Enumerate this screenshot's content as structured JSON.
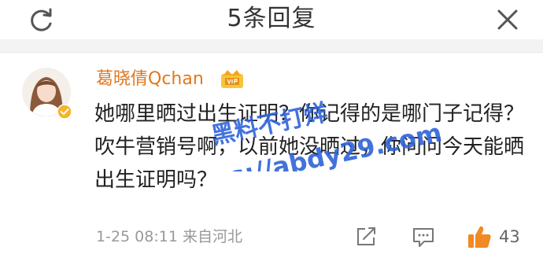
{
  "header": {
    "title": "5条回复",
    "left_icon": "refresh-icon",
    "right_icon": "close-icon"
  },
  "comment": {
    "username": "葛晓倩Qchan",
    "text": "她哪里晒过出生证明？你记得的是哪门子记得？吹牛营销号啊，以前她没晒过，你问问今天能晒出生证明吗？",
    "timestamp": "1-25 08:11",
    "source": "来自河北",
    "like_count": "43",
    "icons": [
      "share-icon",
      "comment-icon",
      "like-icon",
      "verified-icon",
      "vip-crown-icon"
    ]
  },
  "watermark": {
    "line1": "黑料不打烊",
    "line2": "https://abdy29.com"
  },
  "colors": {
    "username": "#e0781e",
    "watermark": "#2e63d8",
    "like": "#f08a24",
    "muted": "#999999"
  }
}
